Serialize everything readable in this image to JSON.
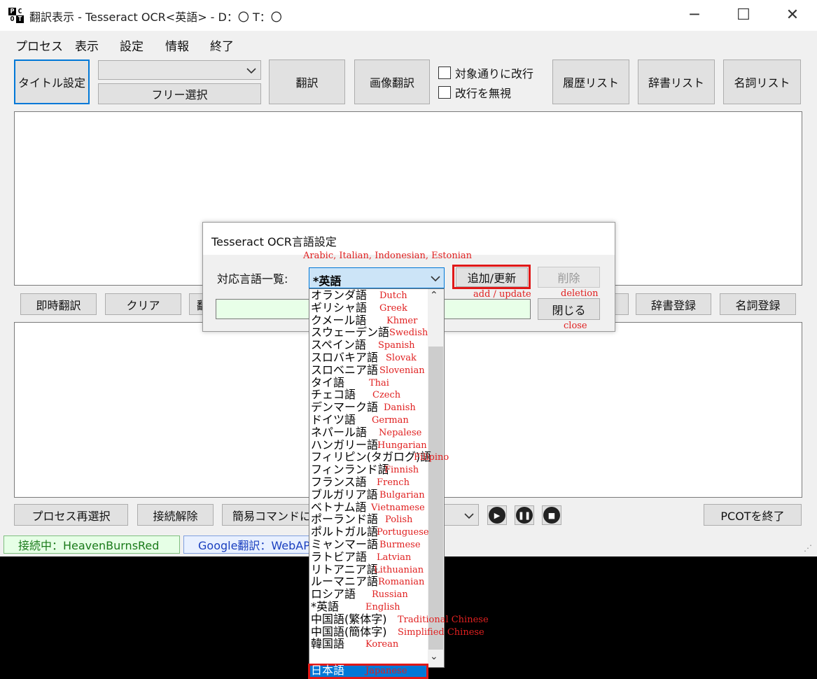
{
  "window": {
    "app_icon_letters": [
      "P",
      "C",
      "O",
      "T"
    ],
    "title": "翻訳表示 - Tesseract OCR<英語> - D：〇 T：〇",
    "controls": {
      "minimize": "─",
      "maximize": "☐",
      "close": "✕"
    }
  },
  "menu": [
    "プロセス",
    "表示",
    "設定",
    "情報",
    "終了"
  ],
  "toolbar": {
    "title_setting": "タイトル設定",
    "process_combo_value": "",
    "free_select": "フリー選択",
    "translate": "翻訳",
    "image_translate": "画像翻訳",
    "wrap_as_target": "対象通りに改行",
    "ignore_newlines": "改行を無視",
    "history_list": "履歴リスト",
    "dictionary_list": "辞書リスト",
    "noun_list": "名詞リスト"
  },
  "middle_bar": {
    "instant_translate": "即時翻訳",
    "clear": "クリア",
    "partial_hidden": "翻",
    "dictionary_register": "辞書登録",
    "noun_register": "名詞登録"
  },
  "bottom_bar": {
    "reselect_process": "プロセス再選択",
    "disconnect": "接続解除",
    "simple_command": "簡易コマンドに任",
    "exit_pcot": "PCOTを終了",
    "media": {
      "play": "▶",
      "pause": "❚❚",
      "stop": "■"
    }
  },
  "status": {
    "connection": "接続中：HeavenBurnsRed",
    "translator": "Google翻訳：WebAPI"
  },
  "dialog": {
    "title": "Tesseract OCR言語設定",
    "language_list_label": "対応言語一覧:",
    "selected_language": "*英語",
    "add_update": "追加/更新",
    "delete": "削除",
    "close": "閉じる",
    "annotations": {
      "missing_languages": "Arabic, Italian, Indonesian, Estonian",
      "add_update": "add / update",
      "deletion": "deletion",
      "close": "close"
    }
  },
  "dropdown": {
    "options": [
      {
        "label": "オランダ語",
        "en": "Dutch"
      },
      {
        "label": "ギリシャ語",
        "en": "Greek"
      },
      {
        "label": "クメール語",
        "en": "Khmer"
      },
      {
        "label": "スウェーデン語",
        "en": "Swedish"
      },
      {
        "label": "スペイン語",
        "en": "Spanish"
      },
      {
        "label": "スロバキア語",
        "en": "Slovak"
      },
      {
        "label": "スロベニア語",
        "en": "Slovenian"
      },
      {
        "label": "タイ語",
        "en": "Thai"
      },
      {
        "label": "チェコ語",
        "en": "Czech"
      },
      {
        "label": "デンマーク語",
        "en": "Danish"
      },
      {
        "label": "ドイツ語",
        "en": "German"
      },
      {
        "label": "ネパール語",
        "en": "Nepalese"
      },
      {
        "label": "ハンガリー語",
        "en": "Hungarian"
      },
      {
        "label": "フィリピン(タガログ)語",
        "en": "Filipino"
      },
      {
        "label": "フィンランド語",
        "en": "Finnish"
      },
      {
        "label": "フランス語",
        "en": "French"
      },
      {
        "label": "ブルガリア語",
        "en": "Bulgarian"
      },
      {
        "label": "ベトナム語",
        "en": "Vietnamese"
      },
      {
        "label": "ポーランド語",
        "en": "Polish"
      },
      {
        "label": "ポルトガル語",
        "en": "Portuguese"
      },
      {
        "label": "ミャンマー語",
        "en": "Burmese"
      },
      {
        "label": "ラトビア語",
        "en": "Latvian"
      },
      {
        "label": "リトアニア語",
        "en": "Lithuanian"
      },
      {
        "label": "ルーマニア語",
        "en": "Romanian"
      },
      {
        "label": "ロシア語",
        "en": "Russian"
      },
      {
        "label": "*英語",
        "en": "English"
      },
      {
        "label": "中国語(繁体字)",
        "en": "Traditional Chinese"
      },
      {
        "label": "中国語(簡体字)",
        "en": "Simplified Chinese"
      },
      {
        "label": "韓国語",
        "en": "Korean"
      },
      {
        "label": "日本語",
        "en": "Japanese",
        "highlighted": true
      }
    ],
    "scroll_up": "⌃",
    "scroll_down": "⌄"
  },
  "colors": {
    "accent_blue": "#0078d7",
    "annotation_red": "#e02020",
    "status_green_bg": "#e6ffe6",
    "status_blue_bg": "#e8f0ff",
    "input_green_bg": "#e8ffe8"
  }
}
